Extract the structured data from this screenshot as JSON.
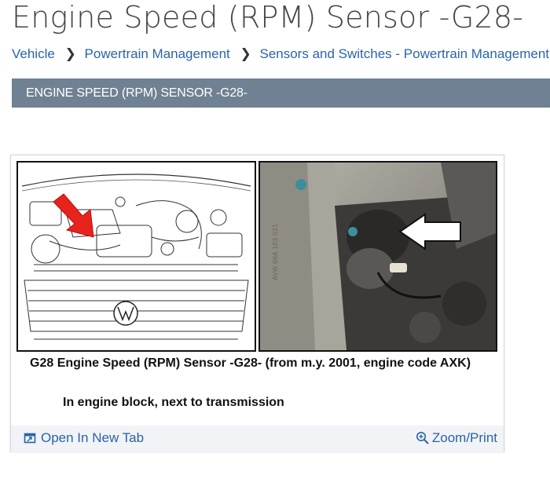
{
  "page": {
    "title": "Engine Speed (RPM) Sensor -G28-"
  },
  "breadcrumb": {
    "items": [
      {
        "label": "Vehicle"
      },
      {
        "label": "Powertrain Management"
      },
      {
        "label": "Sensors and Switches - Powertrain Management"
      }
    ]
  },
  "section": {
    "header": "ENGINE SPEED (RPM) SENSOR -G28-"
  },
  "figure": {
    "caption_line1": "G28  Engine Speed (RPM) Sensor -G28- (from m.y. 2001, engine code AXK)",
    "caption_line2": "In engine block, next to transmission",
    "open_tab_label": "Open In New Tab",
    "zoom_print_label": "Zoom/Print",
    "open_tab_icon": "open-new-tab-icon",
    "zoom_icon": "magnifier-plus-icon"
  },
  "colors": {
    "link": "#2a64a8",
    "section_bar": "#6f8192",
    "arrow_red": "#e8231c"
  }
}
